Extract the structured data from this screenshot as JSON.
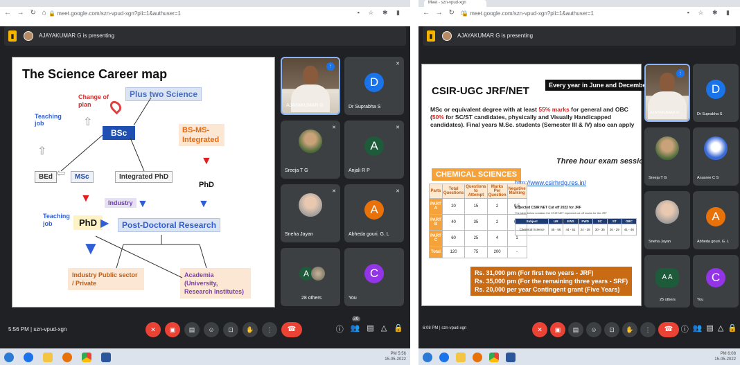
{
  "left": {
    "url": "meet.google.com/szn-vpud-xgn?pli=1&authuser=1",
    "presenting": "AJAYAKUMAR G is presenting",
    "slide": {
      "title": "The Science Career map",
      "change_of_plan": "Change of plan",
      "plus_two": "Plus two Science",
      "teaching_job_top": "Teaching job",
      "bsc": "BSc",
      "bs_ms": "BS-MS-Integrated",
      "bed": "BEd",
      "msc": "MSc",
      "integrated_phd": "Integrated PhD",
      "phd_right": "PhD",
      "industry_small": "Industry",
      "teaching_job_bottom": "Teaching job",
      "phd": "PhD",
      "post_doc": "Post-Doctoral Research",
      "industry_box": "Industry Public sector / Private",
      "academia_box": "Academia (University, Research Institutes)"
    },
    "tiles": [
      {
        "name": "AJAYAKUMAR G",
        "letter": ""
      },
      {
        "name": "Dr Suprabha S",
        "letter": "D"
      },
      {
        "name": "Sreeja T G",
        "letter": ""
      },
      {
        "name": "Anjali R P",
        "letter": "A"
      },
      {
        "name": "Sneha Jayan",
        "letter": ""
      },
      {
        "name": "Abheda gouri. G. L",
        "letter": "A"
      },
      {
        "name": "28 others",
        "letter": "A"
      },
      {
        "name": "You",
        "letter": "C"
      }
    ],
    "time_code": "5:56 PM  |  szn-vpud-xgn",
    "participants_count": "36",
    "tray_time": "PM 5:56",
    "tray_date": "15-05-2022"
  },
  "right": {
    "tab_title": "Meet - szn-vpud-xgn",
    "url": "meet.google.com/szn-vpud-xgn?pli=1&authuser=1",
    "presenting": "AJAYAKUMAR G is presenting",
    "slide": {
      "title": "CSIR-UGC JRF/NET",
      "banner": "Every year in June and December",
      "para_a": "MSc or equivalent degree with at least ",
      "para_pct": "55% marks",
      "para_b": " for general and OBC (",
      "para_pct2": "50%",
      "para_c": " for SC/ST candidates, physically and Visually Handicapped candidates). Final years M.Sc. students (Semester III & IV) also can apply",
      "chem": "CHEMICAL SCIENCES",
      "exam": "Three hour exam session",
      "link": "http://www.csirhrdg.res.in/",
      "table_head": [
        "Parts",
        "Total Questions",
        "Questions to Attempt",
        "Marks Per Question",
        "Negative Marking"
      ],
      "table_rows": [
        [
          "PART A",
          "20",
          "15",
          "2",
          "0.5"
        ],
        [
          "PART B",
          "40",
          "35",
          "2",
          "0.5"
        ],
        [
          "PART C",
          "60",
          "25",
          "4",
          "1"
        ],
        [
          "Total",
          "120",
          "75",
          "200",
          "-"
        ]
      ],
      "cutoff_title": "Expected CSIR NET Cut off 2022 for JRF",
      "cutoff_sub": "The table below contains the CSIR NET expected cut off marks for the JRF",
      "cutoff_head": [
        "Subject",
        "UR",
        "EWS",
        "PWD",
        "SC",
        "ST",
        "OBC"
      ],
      "cutoff_row": [
        "Chemical Science",
        "45 - 56",
        "44 - 51",
        "24 - 28",
        "30 - 35",
        "26 - 29",
        "41 - 46"
      ],
      "stipend": [
        "Rs. 31,000 pm (For first two years - JRF)",
        "Rs. 35,000 pm (For the remaining three years - SRF)",
        "Rs. 20,000 per year Contingent grant (Five Years)"
      ]
    },
    "tiles": [
      {
        "name": "AJAYAKUMAR G",
        "letter": ""
      },
      {
        "name": "Dr Suprabha S",
        "letter": "D"
      },
      {
        "name": "Sreeja T G",
        "letter": ""
      },
      {
        "name": "Anusree C S",
        "letter": ""
      },
      {
        "name": "Sneha Jayan",
        "letter": ""
      },
      {
        "name": "Abheda gouri. G. L",
        "letter": "A"
      },
      {
        "name": "25 others",
        "letter": "A A"
      },
      {
        "name": "You",
        "letter": "C"
      }
    ],
    "time_code": "6:08 PM  |  szn-vpud-xgn",
    "tray_time": "PM 6:08",
    "tray_date": "15-05-2022"
  }
}
